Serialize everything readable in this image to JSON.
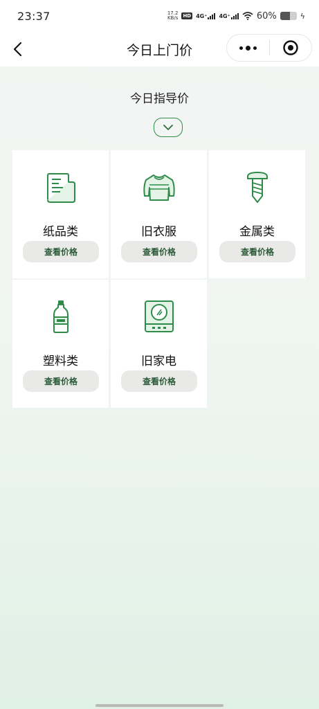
{
  "status_bar": {
    "time": "23:37",
    "net_speed_value": "17.2",
    "net_speed_unit": "KB/s",
    "hd_badge": "HD",
    "signal_1": "4G⁺",
    "signal_2": "4G⁺",
    "battery_percent": "60%",
    "battery_level": 0.6
  },
  "nav": {
    "title": "今日上门价",
    "back_icon": "chevron-left-icon",
    "more_icon": "more-dots-icon",
    "close_icon": "target-circle-icon"
  },
  "section": {
    "title": "今日指导价",
    "expand_icon": "chevron-down-icon"
  },
  "accent_color": "#2e8b4a",
  "categories": [
    {
      "label": "纸品类",
      "button": "查看价格",
      "icon": "paper-icon"
    },
    {
      "label": "旧衣服",
      "button": "查看价格",
      "icon": "sweater-icon"
    },
    {
      "label": "金属类",
      "button": "查看价格",
      "icon": "screw-icon"
    },
    {
      "label": "塑料类",
      "button": "查看价格",
      "icon": "plastic-bottle-icon"
    },
    {
      "label": "旧家电",
      "button": "查看价格",
      "icon": "appliance-icon"
    }
  ]
}
